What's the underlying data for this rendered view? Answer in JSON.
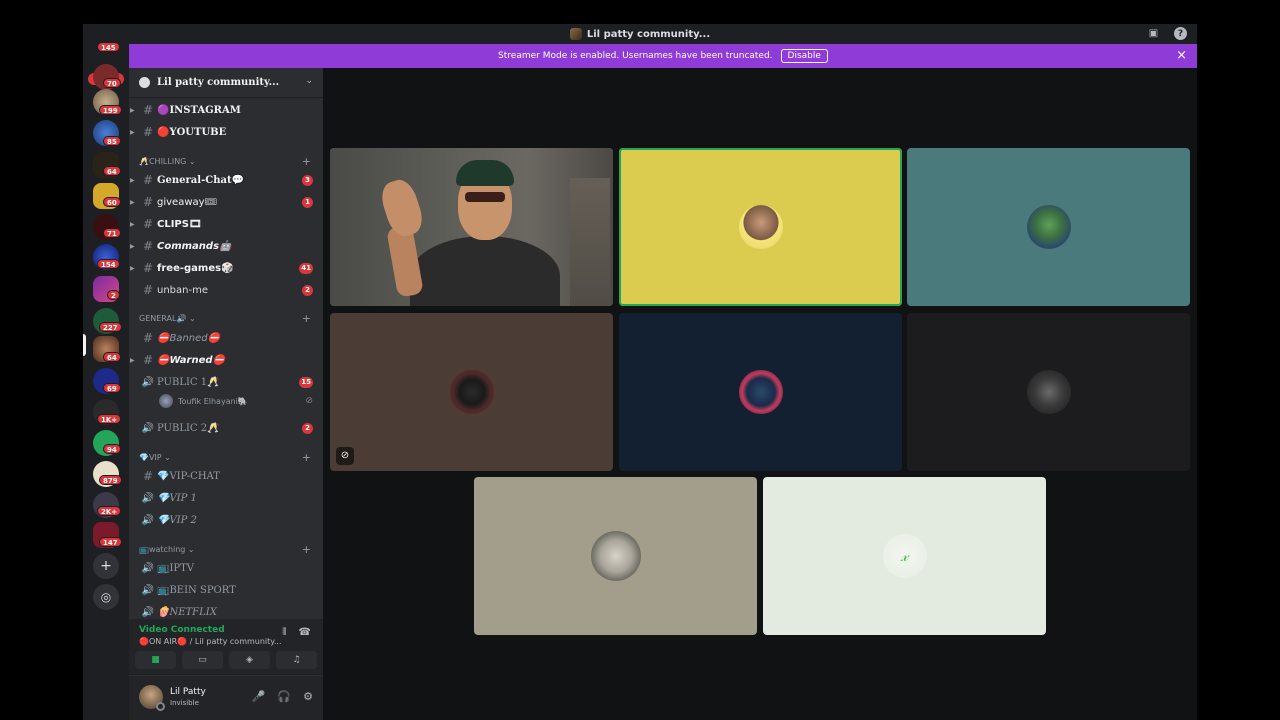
{
  "window": {
    "title": "Lil patty community..."
  },
  "banner": {
    "text": "Streamer Mode is enabled. Usernames have been truncated.",
    "disable_label": "Disable",
    "close_icon": "×"
  },
  "rail": {
    "top_badge": "145",
    "new_label": "NEW",
    "badges": [
      "70",
      "199",
      "85",
      "64",
      "60",
      "71",
      "154",
      "2",
      "227",
      "64",
      "69",
      "1K+",
      "94",
      "879",
      "2K+",
      "147"
    ],
    "add_icon": "+",
    "discover_icon": "◎"
  },
  "guild": {
    "name": "Lil patty community...",
    "chevron": "⌄"
  },
  "channels": {
    "instagram": "🟣INSTAGRAM",
    "youtube": "🔴YOUTUBE",
    "cat_chilling": "🥂CHILLING ⌄",
    "general_chat": "General-Chat💬",
    "general_chat_badge": "3",
    "giveaway": "giveaway🎟",
    "giveaway_badge": "1",
    "clips": "CLIPS🎞",
    "commands": "Commands🤖",
    "free_games": "free-games🎲",
    "free_games_badge": "41",
    "unban_me": "unban-me",
    "unban_me_badge": "2",
    "cat_general": "GENERAL🔊 ⌄",
    "banned": "⛔Banned⛔",
    "warned": "⛔Warned⛔",
    "public1": "PUBLIC 1🥂",
    "public1_badge": "15",
    "voice_user": "Toufik Elhayani🐘",
    "public2": "PUBLIC 2🥂",
    "public2_badge": "2",
    "cat_vip": "💎VIP ⌄",
    "vip_chat": "💎VIP-CHAT",
    "vip1": "💎VIP 1",
    "vip2": "💎VIP 2",
    "cat_watching": "📺watching ⌄",
    "iptv": "📺IPTV",
    "bein": "📺BEIN SPORT",
    "netflix": "🍿NETFLIX"
  },
  "voice_panel": {
    "status": "Video Connected",
    "location": "🔴ON AIR🔴 / Lil patty community..."
  },
  "user": {
    "name": "Lil Patty",
    "status": "Invisible"
  },
  "colors": {
    "accent": "#8e3bd8",
    "speaking": "#23a55a",
    "badge": "#da373c"
  }
}
